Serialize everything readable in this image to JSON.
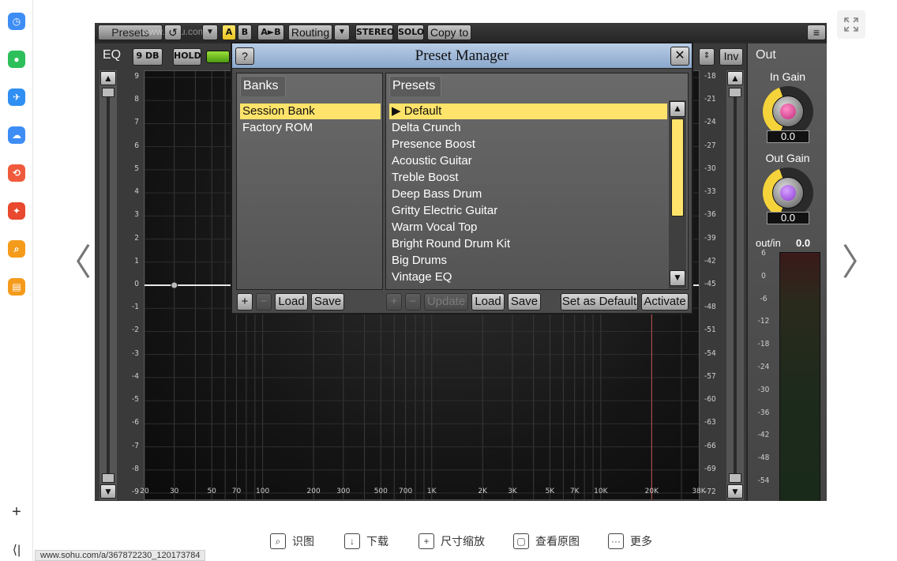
{
  "sidebar": {
    "apps": [
      {
        "name": "clock-app-icon",
        "color": "#3d8df5"
      },
      {
        "name": "wechat-app-icon",
        "color": "#2dbf5a"
      },
      {
        "name": "plane-app-icon",
        "color": "#2f8ff2"
      },
      {
        "name": "cloud-app-icon",
        "color": "#3d8df5"
      },
      {
        "name": "pdf-convert-app-icon",
        "color": "#f05a3c"
      },
      {
        "name": "acrobat-app-icon",
        "color": "#e8492f"
      },
      {
        "name": "search-app-icon",
        "color": "#f59b1c"
      },
      {
        "name": "reader-app-icon",
        "color": "#f59b1c"
      }
    ],
    "add_symbol": "+",
    "collapse_symbol": "⟨|"
  },
  "plugin": {
    "topbar": {
      "presets_label": "Presets",
      "watermark": "www.sohu.com",
      "a_label": "A",
      "b_label": "B",
      "ab_label": "A►B",
      "routing_label": "Routing",
      "stereo_label": "STEREO",
      "solo_label": "SOLO",
      "copy_label": "Copy to"
    },
    "eq": {
      "tab_label": "EQ",
      "db_label": "9 DB",
      "hold_label": "HOLD",
      "inv_label": "Inv",
      "left_scale": [
        "9",
        "8",
        "7",
        "6",
        "5",
        "4",
        "3",
        "2",
        "1",
        "0",
        "-1",
        "-2",
        "-3",
        "-4",
        "-5",
        "-6",
        "-7",
        "-8",
        "-9"
      ],
      "right_scale": [
        "-18",
        "-21",
        "-24",
        "-27",
        "-30",
        "-33",
        "-36",
        "-39",
        "-42",
        "-45",
        "-48",
        "-51",
        "-54",
        "-57",
        "-60",
        "-63",
        "-66",
        "-69",
        "-72"
      ],
      "freq_labels": [
        "20",
        "30",
        "50",
        "70",
        "100",
        "200",
        "300",
        "500",
        "700",
        "1K",
        "2K",
        "3K",
        "5K",
        "7K",
        "10K",
        "20K",
        "38K"
      ]
    },
    "out": {
      "tab_label": "Out",
      "in_gain_label": "In Gain",
      "in_gain_value": "0.0",
      "out_gain_label": "Out Gain",
      "out_gain_value": "0.0",
      "outin_label": "out/in",
      "outin_value": "0.0",
      "meter_scale": [
        "6",
        "0",
        "-6",
        "-12",
        "-18",
        "-24",
        "-30",
        "-36",
        "-42",
        "-48",
        "-54"
      ]
    }
  },
  "dialog": {
    "help_label": "?",
    "title": "Preset Manager",
    "close_label": "✕",
    "banks_tab": "Banks",
    "banks": [
      {
        "label": "Session Bank",
        "selected": true
      },
      {
        "label": "Factory ROM",
        "selected": false
      }
    ],
    "presets_tab": "Presets",
    "presets": [
      {
        "label": "▶ Default",
        "selected": true
      },
      {
        "label": "Delta Crunch",
        "selected": false
      },
      {
        "label": "Presence Boost",
        "selected": false
      },
      {
        "label": "Acoustic Guitar",
        "selected": false
      },
      {
        "label": "Treble Boost",
        "selected": false
      },
      {
        "label": "Deep Bass Drum",
        "selected": false
      },
      {
        "label": "Gritty Electric Guitar",
        "selected": false
      },
      {
        "label": "Warm Vocal Top",
        "selected": false
      },
      {
        "label": "Bright Round Drum Kit",
        "selected": false
      },
      {
        "label": "Big Drums",
        "selected": false
      },
      {
        "label": "Vintage EQ",
        "selected": false
      }
    ],
    "bank_buttons": {
      "add": "+",
      "remove": "−",
      "load": "Load",
      "save": "Save"
    },
    "preset_buttons": {
      "add": "+",
      "remove": "−",
      "update": "Update",
      "load": "Load",
      "save": "Save",
      "set_default": "Set as Default",
      "activate": "Activate"
    }
  },
  "viewer": {
    "prev_symbol": "〈",
    "next_symbol": "〉",
    "actions": {
      "recognize": "识图",
      "download": "下载",
      "resize": "尺寸缩放",
      "original": "查看原图",
      "more": "更多"
    },
    "url": "www.sohu.com/a/367872230_120173784"
  }
}
